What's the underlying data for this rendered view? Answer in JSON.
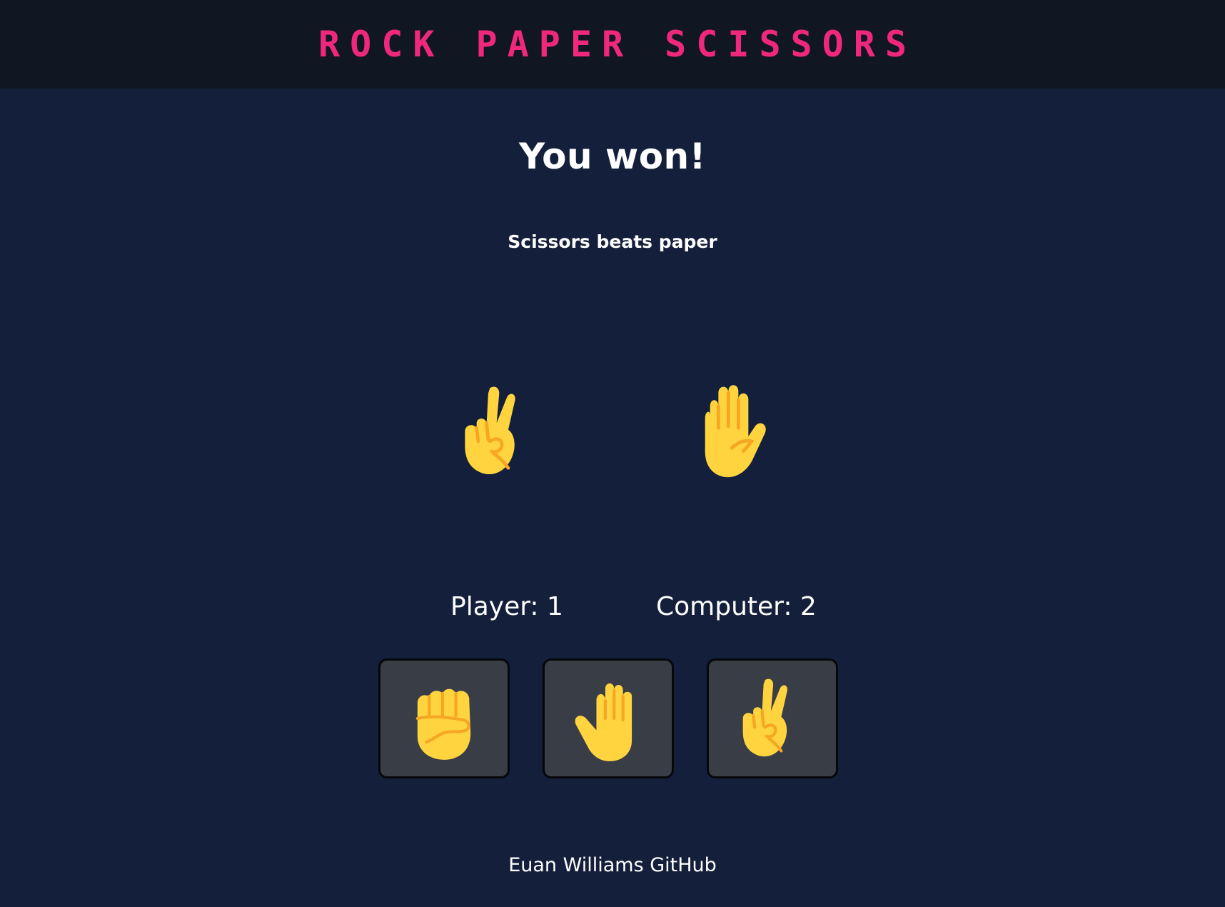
{
  "header": {
    "title": "Rock Paper Scissors"
  },
  "result": {
    "message": "You won!",
    "reason": "Scissors beats paper"
  },
  "round": {
    "player_choice_icon": "victory-hand",
    "computer_choice_icon": "raised-hand"
  },
  "score": {
    "player_text": "Player: 1",
    "computer_text": "Computer: 2"
  },
  "buttons": [
    {
      "name": "rock",
      "icon": "raised-fist"
    },
    {
      "name": "paper",
      "icon": "raised-back-of-hand"
    },
    {
      "name": "scissors",
      "icon": "victory-hand"
    }
  ],
  "footer": {
    "link_text": "Euan Williams GitHub"
  },
  "colors": {
    "title_accent": "#f0287d",
    "header_bg": "#111722",
    "page_bg": "#14203b",
    "button_bg": "#393d46",
    "hand_yellow": "#ffd43f",
    "hand_shade": "#f6a623"
  }
}
